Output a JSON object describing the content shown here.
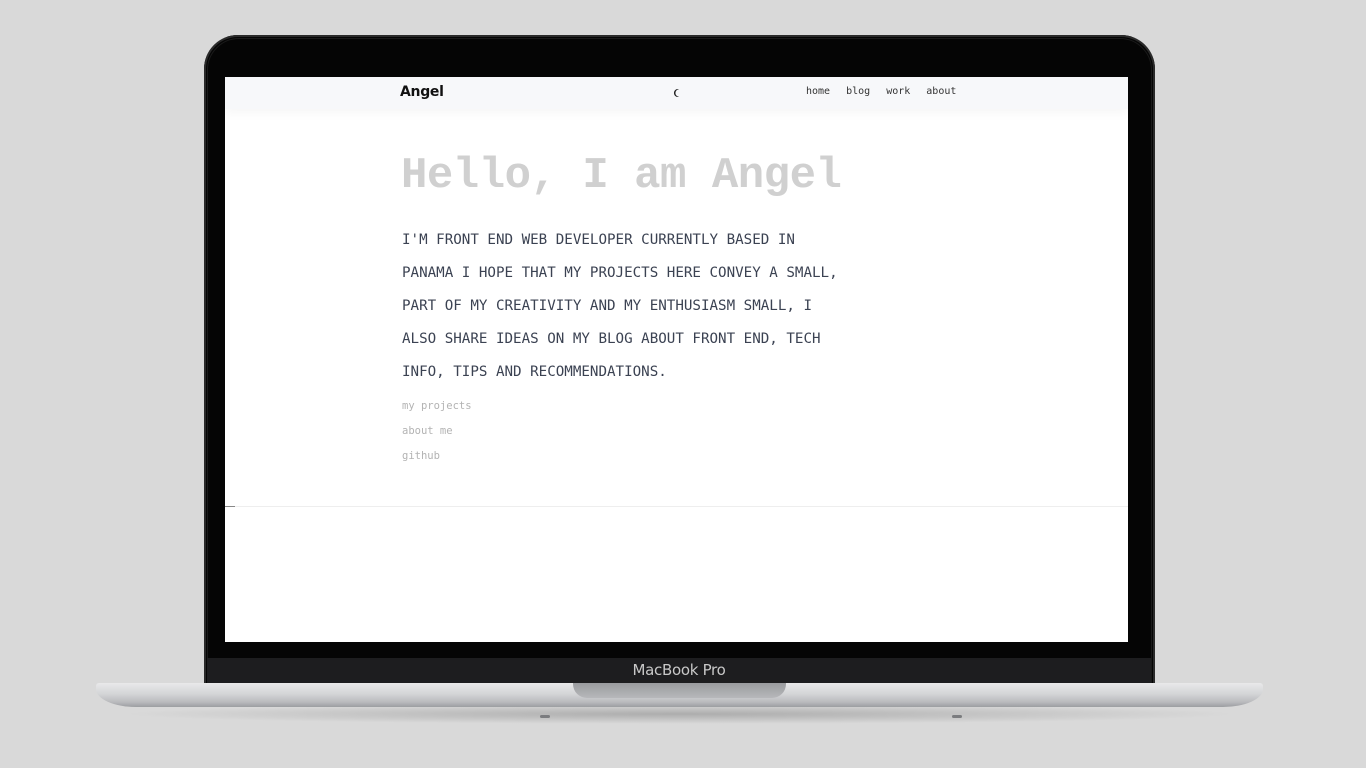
{
  "device": {
    "brand_label": "MacBook Pro"
  },
  "navbar": {
    "logo": "Angel",
    "theme_toggle_icon": "moon-icon",
    "links": [
      "home",
      "blog",
      "work",
      "about"
    ]
  },
  "hero": {
    "title": "Hello, I am Angel",
    "description": "I'M FRONT END WEB DEVELOPER CURRENTLY BASED IN PANAMA I HOPE THAT MY PROJECTS HERE CONVEY A SMALL, PART OF MY CREATIVITY AND MY ENTHUSIASM SMALL, I ALSO SHARE IDEAS ON MY BLOG ABOUT FRONT END, TECH INFO, TIPS AND RECOMMENDATIONS.",
    "links": [
      "my projects",
      "about me",
      "github"
    ]
  },
  "colors": {
    "background": "#d9d9d9",
    "navbar_bg": "#f7f8fa",
    "title": "#d0d0d0",
    "description": "#3b4252",
    "muted_link": "#b3b3b3"
  }
}
